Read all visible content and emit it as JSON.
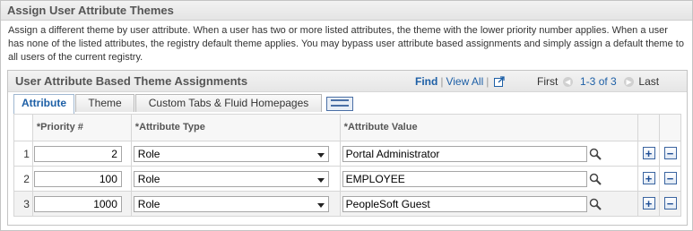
{
  "page": {
    "title": "Assign User Attribute Themes",
    "description": "Assign a different theme by user attribute. When a user has two or more listed attributes, the theme with the lower priority number applies. When a user has none of the listed attributes, the registry default theme applies. You may bypass user attribute based assignments and simply assign a default theme to all users of the current registry."
  },
  "grid": {
    "title": "User Attribute Based Theme Assignments",
    "find": "Find",
    "separator": "|",
    "view_all": "View All",
    "pager": {
      "first": "First",
      "count": "1-3 of 3",
      "last": "Last"
    },
    "tabs": [
      "Attribute",
      "Theme",
      "Custom Tabs & Fluid Homepages"
    ],
    "columns": {
      "priority": "*Priority #",
      "attribute_type": "*Attribute Type",
      "attribute_value": "*Attribute Value"
    },
    "rows": [
      {
        "num": "1",
        "priority": "2",
        "type": "Role",
        "value": "Portal Administrator"
      },
      {
        "num": "2",
        "priority": "100",
        "type": "Role",
        "value": "EMPLOYEE"
      },
      {
        "num": "3",
        "priority": "1000",
        "type": "Role",
        "value": "PeopleSoft Guest"
      }
    ],
    "add_symbol": "+",
    "delete_symbol": "−"
  },
  "colors": {
    "link": "#1d5fa6",
    "header_text": "#555555",
    "alt_row": "#f2f2f2"
  },
  "icons": [
    "export-icon",
    "first-arrow-icon",
    "next-arrow-icon",
    "show-all-tabs-icon",
    "lookup-icon",
    "add-row-icon",
    "delete-row-icon"
  ]
}
